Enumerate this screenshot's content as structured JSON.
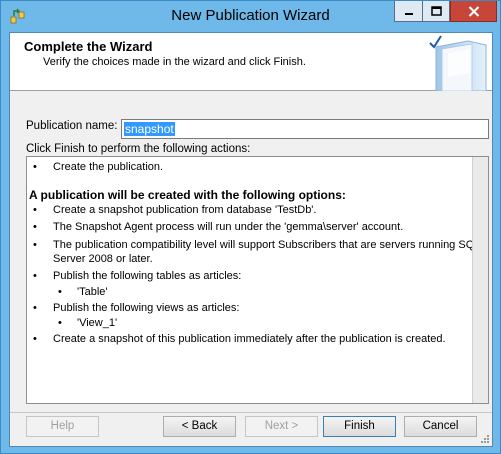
{
  "window": {
    "title": "New Publication Wizard"
  },
  "header": {
    "title": "Complete the Wizard",
    "subtitle": "Verify the choices made in the wizard and click Finish."
  },
  "form": {
    "pub_name_label": "Publication name:",
    "pub_name_value": "snapshot",
    "actions_label": "Click Finish to perform the following actions:"
  },
  "summary": {
    "action_1": "Create the publication.",
    "options_heading": "A publication will be created with the following options:",
    "opt_1": "Create a snapshot publication from database 'TestDb'.",
    "opt_2": "The Snapshot Agent process will run under the 'gemma\\server' account.",
    "opt_3_line1": "The publication compatibility level will support Subscribers that are servers running SQL",
    "opt_3_line2": "Server 2008 or later.",
    "opt_4": "Publish the following tables as articles:",
    "opt_4_item": "'Table'",
    "opt_5": "Publish the following views as articles:",
    "opt_5_item": "'View_1'",
    "opt_6": "Create a snapshot of this publication immediately after the publication is created.",
    "bullet": "•"
  },
  "buttons": {
    "help": "Help",
    "back": "< Back",
    "next": "Next >",
    "finish": "Finish",
    "cancel": "Cancel"
  },
  "colors": {
    "titlebar": "#6fb8ea",
    "close_button": "#c7463a",
    "selection": "#3399ff"
  },
  "icons": [
    "wizard-app-icon",
    "minimize-icon",
    "maximize-icon",
    "close-icon",
    "book-checkmark-icon",
    "resize-grip-icon"
  ]
}
